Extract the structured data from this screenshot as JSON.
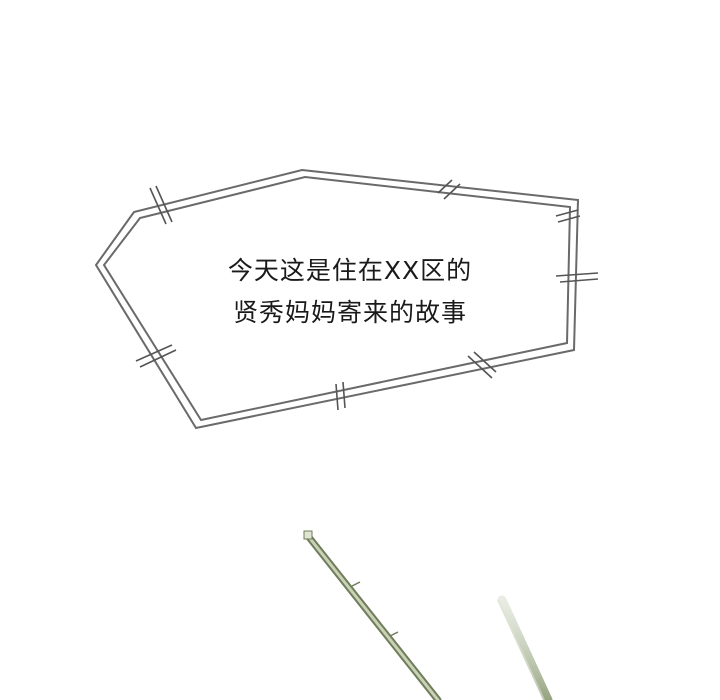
{
  "panel": {
    "narration": {
      "line1": "今天这是住在XX区的",
      "line2": "贤秀妈妈寄来的故事"
    }
  },
  "colors": {
    "background": "#ffffff",
    "bubble_stroke": "#555555",
    "text": "#1a1a1a",
    "stick_green": "#7d8c66"
  }
}
